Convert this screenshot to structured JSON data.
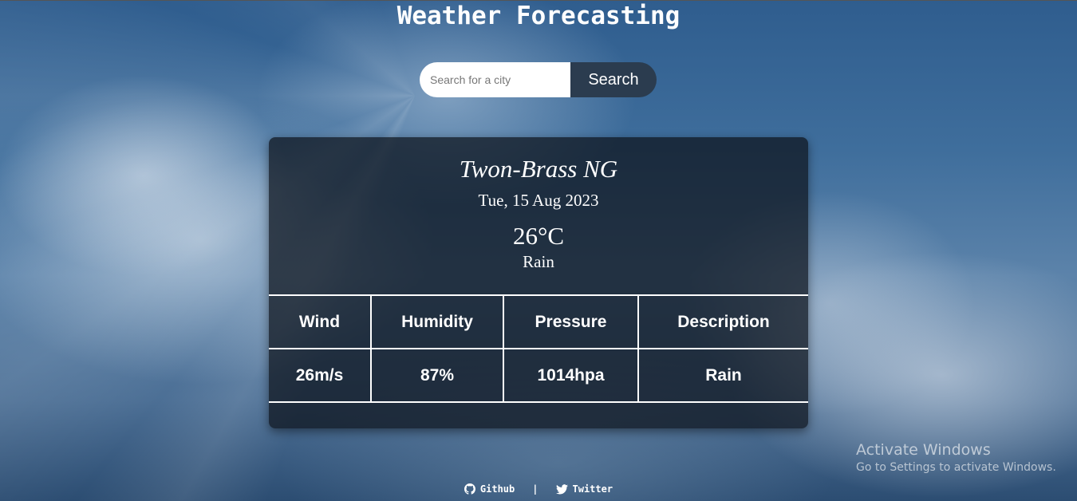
{
  "header": {
    "title": "Weather Forecasting"
  },
  "search": {
    "placeholder": "Search for a city",
    "button_label": "Search"
  },
  "weather": {
    "city": "Twon-Brass NG",
    "date": "Tue, 15 Aug 2023",
    "temperature": "26°C",
    "condition": "Rain",
    "columns": [
      "Wind",
      "Humidity",
      "Pressure",
      "Description"
    ],
    "values": [
      "26m/s",
      "87%",
      "1014hpa",
      "Rain"
    ]
  },
  "footer": {
    "links": [
      {
        "label": "Github",
        "icon": "github-icon"
      },
      {
        "label": "Twitter",
        "icon": "twitter-icon"
      }
    ],
    "separator": "|"
  },
  "watermark": {
    "title": "Activate Windows",
    "subtitle": "Go to Settings to activate Windows."
  },
  "colors": {
    "search_button": "#2b3c4f",
    "card_background": "rgba(12,18,26,0.72)",
    "text": "#ffffff"
  }
}
